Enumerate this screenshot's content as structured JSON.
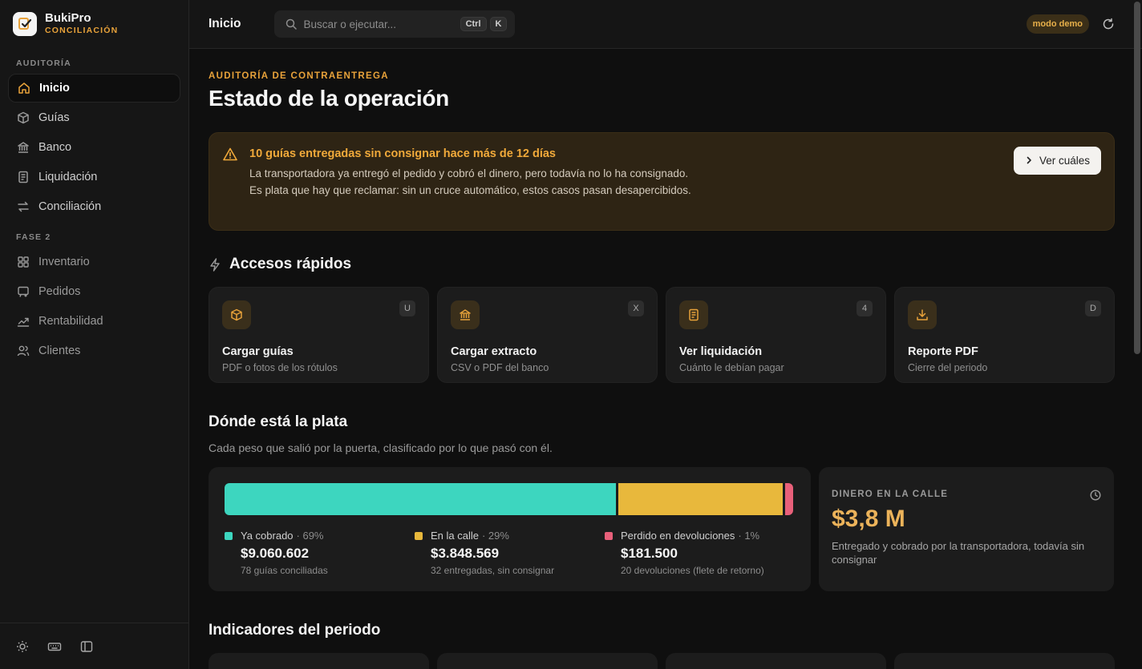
{
  "brand": {
    "name": "BukiPro",
    "subtitle": "CONCILIACIÓN"
  },
  "sidebar": {
    "section1": "AUDITORÍA",
    "items1": [
      {
        "label": "Inicio",
        "icon": "home-icon"
      },
      {
        "label": "Guías",
        "icon": "box-icon"
      },
      {
        "label": "Banco",
        "icon": "bank-icon"
      },
      {
        "label": "Liquidación",
        "icon": "document-icon"
      },
      {
        "label": "Conciliación",
        "icon": "swap-icon"
      }
    ],
    "section2": "FASE 2",
    "items2": [
      {
        "label": "Inventario",
        "icon": "grid-icon"
      },
      {
        "label": "Pedidos",
        "icon": "cart-icon"
      },
      {
        "label": "Rentabilidad",
        "icon": "trend-icon"
      },
      {
        "label": "Clientes",
        "icon": "users-icon"
      }
    ]
  },
  "topbar": {
    "title": "Inicio",
    "search_placeholder": "Buscar o ejecutar...",
    "kbd1": "Ctrl",
    "kbd2": "K",
    "demo": "modo demo"
  },
  "header": {
    "eyebrow": "AUDITORÍA DE CONTRAENTREGA",
    "title": "Estado de la operación"
  },
  "alert": {
    "title": "10 guías entregadas sin consignar hace más de 12 días",
    "body": "La transportadora ya entregó el pedido y cobró el dinero, pero todavía no lo ha consignado. Es plata que hay que reclamar: sin un cruce automático, estos casos pasan desapercibidos.",
    "button": "Ver cuáles"
  },
  "quick": {
    "title": "Accesos rápidos",
    "cards": [
      {
        "title": "Cargar guías",
        "sub": "PDF o fotos de los rótulos",
        "key": "U",
        "icon": "box-icon"
      },
      {
        "title": "Cargar extracto",
        "sub": "CSV o PDF del banco",
        "key": "X",
        "icon": "bank-icon"
      },
      {
        "title": "Ver liquidación",
        "sub": "Cuánto le debían pagar",
        "key": "4",
        "icon": "document-icon"
      },
      {
        "title": "Reporte PDF",
        "sub": "Cierre del periodo",
        "key": "D",
        "icon": "download-icon"
      }
    ]
  },
  "money": {
    "title": "Dónde está la plata",
    "subtitle": "Cada peso que salió por la puerta, clasificado por lo que pasó con él.",
    "segments": [
      {
        "label": "Ya cobrado",
        "pct_label": "· 69%",
        "share": 69,
        "amount": "$9.060.602",
        "note": "78 guías conciliadas",
        "color": "#3dd6bf"
      },
      {
        "label": "En la calle",
        "pct_label": "· 29%",
        "share": 29,
        "amount": "$3.848.569",
        "note": "32 entregadas, sin consignar",
        "color": "#e8b83c"
      },
      {
        "label": "Perdido en devoluciones",
        "pct_label": "· 1%",
        "share": 1.4,
        "amount": "$181.500",
        "note": "20 devoluciones (flete de retorno)",
        "color": "#e8607a"
      }
    ]
  },
  "street": {
    "label": "DINERO EN LA CALLE",
    "value": "$3,8 M",
    "note": "Entregado y cobrado por la transportadora, todavía sin consignar"
  },
  "indicators": {
    "title": "Indicadores del periodo"
  }
}
